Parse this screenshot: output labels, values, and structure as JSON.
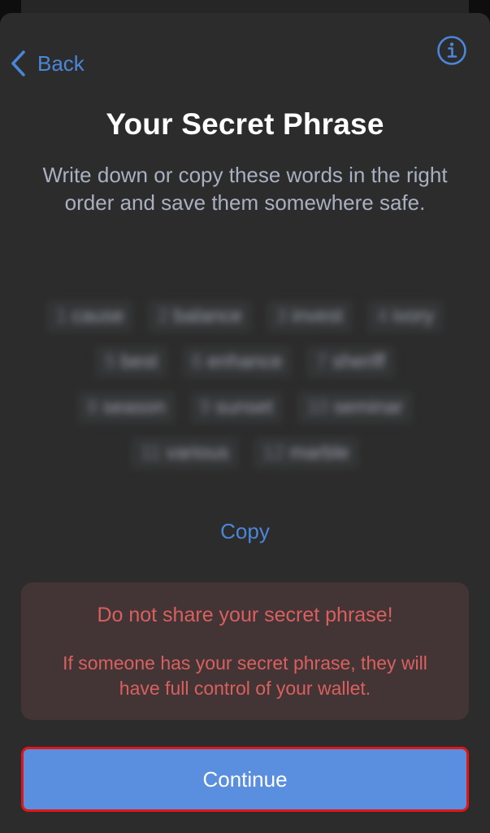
{
  "nav": {
    "back_label": "Back",
    "info_icon": "info-icon"
  },
  "header": {
    "title": "Your Secret Phrase",
    "subtitle": "Write down or copy these words in the right order and save them somewhere safe."
  },
  "phrase": {
    "words": [
      {
        "num": "1",
        "word": "cause"
      },
      {
        "num": "2",
        "word": "balance"
      },
      {
        "num": "3",
        "word": "invest"
      },
      {
        "num": "4",
        "word": "ivory"
      },
      {
        "num": "5",
        "word": "best"
      },
      {
        "num": "6",
        "word": "enhance"
      },
      {
        "num": "7",
        "word": "sheriff"
      },
      {
        "num": "8",
        "word": "season"
      },
      {
        "num": "9",
        "word": "sunset"
      },
      {
        "num": "10",
        "word": "seminar"
      },
      {
        "num": "11",
        "word": "various"
      },
      {
        "num": "12",
        "word": "marble"
      }
    ],
    "copy_label": "Copy"
  },
  "warning": {
    "title": "Do not share your secret phrase!",
    "text": "If someone has your secret phrase, they will have full control of your wallet."
  },
  "footer": {
    "continue_label": "Continue"
  },
  "colors": {
    "background": "#2c2c2c",
    "accent": "#4c86d9",
    "button": "#5a8ede",
    "warning_bg": "#433535",
    "warning_text": "#d9605e",
    "highlight_border": "#e21616"
  }
}
